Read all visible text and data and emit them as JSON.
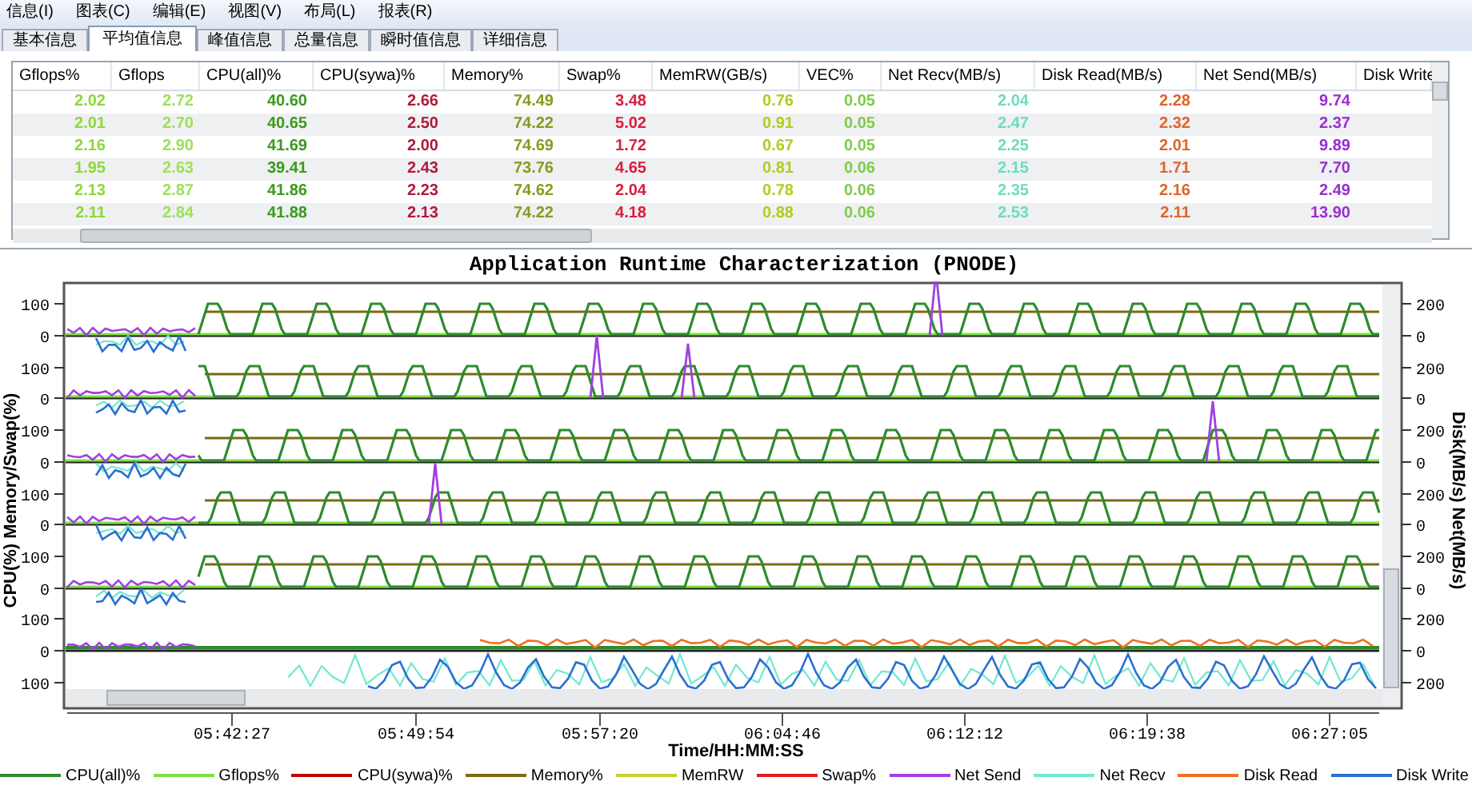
{
  "menu": [
    "信息(I)",
    "图表(C)",
    "编辑(E)",
    "视图(V)",
    "布局(L)",
    "报表(R)"
  ],
  "tabs": [
    {
      "label": "基本信息",
      "selected": false
    },
    {
      "label": "平均值信息",
      "selected": true
    },
    {
      "label": "峰值信息",
      "selected": false
    },
    {
      "label": "总量信息",
      "selected": false
    },
    {
      "label": "瞬时值信息",
      "selected": false
    },
    {
      "label": "详细信息",
      "selected": false
    }
  ],
  "table": {
    "columns": [
      {
        "label": "Gflops%",
        "color": "#8ed83a"
      },
      {
        "label": "Gflops",
        "color": "#9ee05a"
      },
      {
        "label": "CPU(all)%",
        "color": "#3c9a1c"
      },
      {
        "label": "CPU(sywa)%",
        "color": "#b01a3a"
      },
      {
        "label": "Memory%",
        "color": "#8a9a1e"
      },
      {
        "label": "Swap%",
        "color": "#d81e40"
      },
      {
        "label": "MemRW(GB/s)",
        "color": "#b4cc1e"
      },
      {
        "label": "VEC%",
        "color": "#80cc48"
      },
      {
        "label": "Net Recv(MB/s)",
        "color": "#6edcc0"
      },
      {
        "label": "Disk Read(MB/s)",
        "color": "#e0642a"
      },
      {
        "label": "Net Send(MB/s)",
        "color": "#9a2ed0"
      },
      {
        "label": "Disk Write"
      }
    ],
    "rows": [
      [
        "2.02",
        "2.72",
        "40.60",
        "2.66",
        "74.49",
        "3.48",
        "0.76",
        "0.05",
        "2.04",
        "2.28",
        "9.74"
      ],
      [
        "2.01",
        "2.70",
        "40.65",
        "2.50",
        "74.22",
        "5.02",
        "0.91",
        "0.05",
        "2.47",
        "2.32",
        "2.37"
      ],
      [
        "2.16",
        "2.90",
        "41.69",
        "2.00",
        "74.69",
        "1.72",
        "0.67",
        "0.05",
        "2.25",
        "2.01",
        "9.89"
      ],
      [
        "1.95",
        "2.63",
        "39.41",
        "2.43",
        "73.76",
        "4.65",
        "0.81",
        "0.06",
        "2.15",
        "1.71",
        "7.70"
      ],
      [
        "2.13",
        "2.87",
        "41.86",
        "2.23",
        "74.62",
        "2.04",
        "0.78",
        "0.06",
        "2.35",
        "2.16",
        "2.49"
      ],
      [
        "2.11",
        "2.84",
        "41.88",
        "2.13",
        "74.22",
        "4.18",
        "0.88",
        "0.06",
        "2.53",
        "2.11",
        "13.90"
      ]
    ]
  },
  "chart": {
    "title": "Application Runtime Characterization (PNODE)",
    "y_left_label": "CPU(%) Memory/Swap(%)",
    "y_right_label": "Disk(MB/s) Net(MB/s)",
    "left_ticks": [
      "100",
      "0",
      "100",
      "0",
      "100",
      "0",
      "100",
      "0",
      "100",
      "0",
      "100",
      "0",
      "100"
    ],
    "right_ticks": [
      "200",
      "0",
      "200",
      "0",
      "200",
      "0",
      "200",
      "0",
      "200",
      "0",
      "200",
      "0",
      "200"
    ],
    "x_ticks": [
      "05:42:27",
      "05:49:54",
      "05:57:20",
      "06:04:46",
      "06:12:12",
      "06:19:38",
      "06:27:05"
    ],
    "x_label": "Time/HH:MM:SS",
    "legend": [
      {
        "label": "CPU(all)%",
        "color": "#2e8b2e"
      },
      {
        "label": "Gflops%",
        "color": "#7ee040"
      },
      {
        "label": "CPU(sywa)%",
        "color": "#c00000"
      },
      {
        "label": "Memory%",
        "color": "#7a6a10"
      },
      {
        "label": "MemRW",
        "color": "#c8d030"
      },
      {
        "label": "Swap%",
        "color": "#e02020"
      },
      {
        "label": "Net Send",
        "color": "#a040e0"
      },
      {
        "label": "Net Recv",
        "color": "#70e8d0"
      },
      {
        "label": "Disk Read",
        "color": "#f07020"
      },
      {
        "label": "Disk Write",
        "color": "#2a70d0"
      }
    ]
  }
}
